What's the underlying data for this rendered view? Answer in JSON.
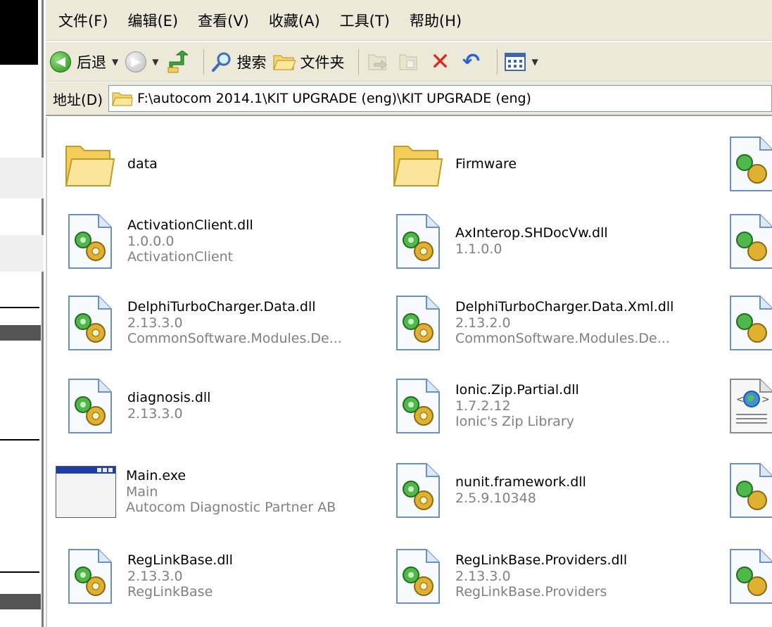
{
  "menu": [
    "文件(F)",
    "编辑(E)",
    "查看(V)",
    "收藏(A)",
    "工具(T)",
    "帮助(H)"
  ],
  "toolbar": {
    "back_label": "后退",
    "search_label": "搜索",
    "folders_label": "文件夹"
  },
  "address": {
    "label": "地址(D)",
    "path": "F:\\autocom 2014.1\\KIT UPGRADE (eng)\\KIT UPGRADE (eng)"
  },
  "files": [
    {
      "name": "data",
      "line2": "",
      "line3": "",
      "icon": "folder-icon"
    },
    {
      "name": "Firmware",
      "line2": "",
      "line3": "",
      "icon": "folder-icon"
    },
    {
      "name": "ActivationClient.dll",
      "line2": "1.0.0.0",
      "line3": "ActivationClient",
      "icon": "dll-icon"
    },
    {
      "name": "AxInterop.SHDocVw.dll",
      "line2": "1.1.0.0",
      "line3": "",
      "icon": "dll-icon"
    },
    {
      "name": "DelphiTurboCharger.Data.dll",
      "line2": "2.13.3.0",
      "line3": "CommonSoftware.Modules.De...",
      "icon": "dll-icon"
    },
    {
      "name": "DelphiTurboCharger.Data.Xml.dll",
      "line2": "2.13.2.0",
      "line3": "CommonSoftware.Modules.De...",
      "icon": "dll-icon"
    },
    {
      "name": "diagnosis.dll",
      "line2": "2.13.3.0",
      "line3": "",
      "icon": "dll-icon"
    },
    {
      "name": "Ionic.Zip.Partial.dll",
      "line2": "1.7.2.12",
      "line3": "Ionic's Zip Library",
      "icon": "dll-icon"
    },
    {
      "name": "Main.exe",
      "line2": "Main",
      "line3": "Autocom Diagnostic Partner AB",
      "icon": "exe-icon"
    },
    {
      "name": "nunit.framework.dll",
      "line2": "2.5.9.10348",
      "line3": "",
      "icon": "dll-icon"
    },
    {
      "name": "RegLinkBase.dll",
      "line2": "2.13.3.0",
      "line3": "RegLinkBase",
      "icon": "dll-icon"
    },
    {
      "name": "RegLinkBase.Providers.dll",
      "line2": "2.13.3.0",
      "line3": "RegLinkBase.Providers",
      "icon": "dll-icon"
    }
  ],
  "right_column_icons": [
    "dll-icon",
    "dll-icon",
    "dll-icon",
    "html-file-icon",
    "dll-icon",
    "dll-icon"
  ]
}
